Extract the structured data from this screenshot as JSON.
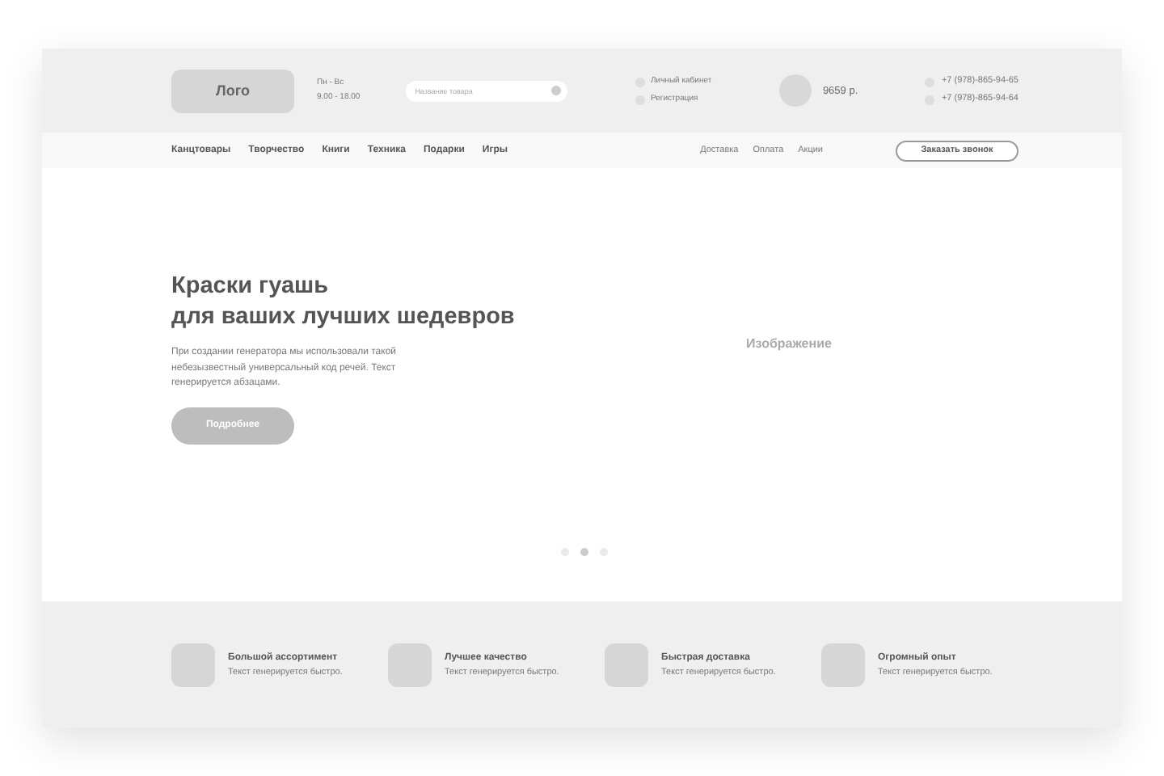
{
  "header": {
    "logo": "Лого",
    "hours": [
      "Пн - Вс",
      "9.00 - 18.00"
    ],
    "search": {
      "placeholder": "Название товара"
    },
    "account_links": [
      "Личный кабинет",
      "Регистрация"
    ],
    "cart_total": "9659 р.",
    "phones": [
      "+7 (978)-865-94-65",
      "+7 (978)-865-94-64"
    ]
  },
  "nav": {
    "categories": [
      "Канцтовары",
      "Творчество",
      "Книги",
      "Техника",
      "Подарки",
      "Игры"
    ],
    "links": [
      "Доставка",
      "Оплата",
      "Акции"
    ],
    "callback_button": "Заказать звонок"
  },
  "hero": {
    "title_lines": [
      "Краски гуашь",
      "для ваших лучших шедевров"
    ],
    "text": "При создании генератора мы использовали такой небезызвестный универсальный код речей. Текст генерируется абзацами.",
    "button": "Подробнее",
    "image_label": "Изображение",
    "slides": [
      {
        "selected": false
      },
      {
        "selected": true
      },
      {
        "selected": false
      }
    ]
  },
  "features": [
    {
      "title": "Большой ассортимент",
      "text": "Текст генерируется быстро."
    },
    {
      "title": "Лучшее качество",
      "text": "Текст генерируется быстро."
    },
    {
      "title": "Быстрая доставка",
      "text": "Текст генерируется быстро."
    },
    {
      "title": "Огромный опыт",
      "text": "Текст генерируется быстро."
    }
  ]
}
